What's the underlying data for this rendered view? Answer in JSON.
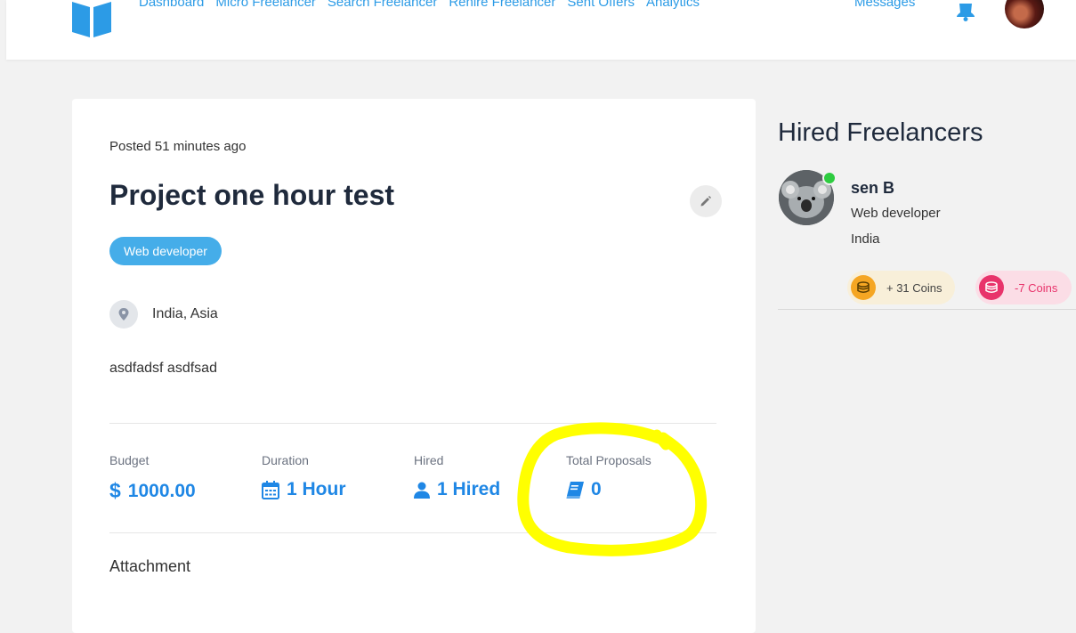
{
  "header": {
    "nav": [
      "Dashboard",
      "Micro Freelancer",
      "Search Freelancer",
      "Rehire Freelancer",
      "Sent Offers",
      "Analytics"
    ],
    "messages_label": "Messages"
  },
  "job": {
    "posted": "Posted 51 minutes ago",
    "title": "Project one hour test",
    "tag": "Web developer",
    "location": "India, Asia",
    "description": "asdfadsf asdfsad",
    "stats": [
      {
        "label": "Budget",
        "value": "1000.00",
        "icon": "dollar-icon"
      },
      {
        "label": "Duration",
        "value": "1 Hour",
        "icon": "calendar-icon"
      },
      {
        "label": "Hired",
        "value": "1 Hired",
        "icon": "user-icon"
      },
      {
        "label": "Total Proposals",
        "value": "0",
        "icon": "book-icon"
      }
    ],
    "attachment_label": "Attachment"
  },
  "hired_panel": {
    "title": "Hired Freelancers",
    "freelancer": {
      "name": "sen B",
      "role": "Web developer",
      "country": "India",
      "coins_plus": "+ 31 Coins",
      "coins_minus": "-7 Coins"
    }
  },
  "colors": {
    "accent": "#1f87e5",
    "nav_link": "#2c9be6",
    "tag_bg": "#45ade9",
    "annotation": "#ffff00",
    "coin_gold": "#f5a623",
    "coin_pink": "#e8336b"
  }
}
